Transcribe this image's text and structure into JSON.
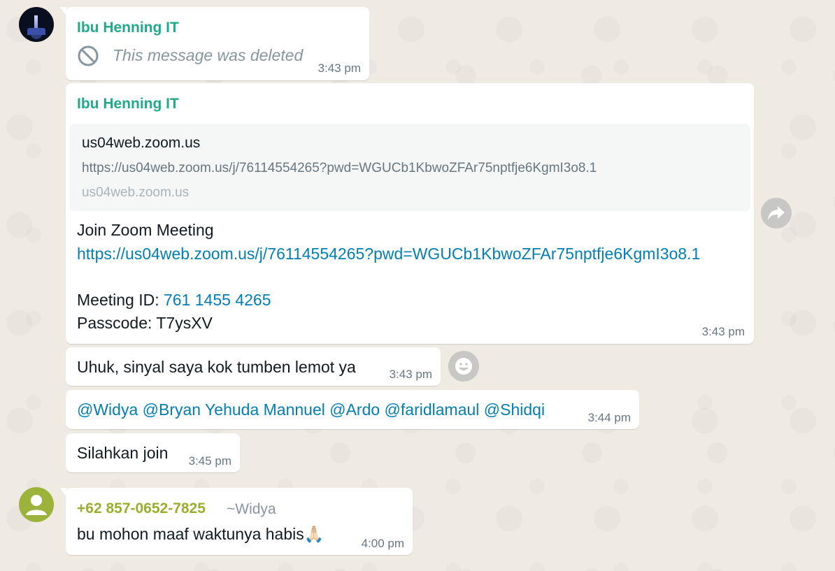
{
  "messages": {
    "m1": {
      "sender": "Ibu Henning IT",
      "deleted_text": "This message was deleted",
      "time": "3:43 pm"
    },
    "m2": {
      "sender": "Ibu Henning IT",
      "preview": {
        "title": "us04web.zoom.us",
        "description": "https://us04web.zoom.us/j/76114554265?pwd=WGUCb1KbwoZFAr75nptfje6KgmI3o8.1",
        "domain": "us04web.zoom.us"
      },
      "line1": "Join Zoom Meeting",
      "link": "https://us04web.zoom.us/j/76114554265?pwd=WGUCb1KbwoZFAr75nptfje6KgmI3o8.1",
      "meeting_id_label": "Meeting ID: ",
      "meeting_id_value": "761 1455 4265",
      "passcode": "Passcode: T7ysXV",
      "time": "3:43 pm"
    },
    "m3": {
      "text": "Uhuk, sinyal saya kok tumben lemot ya",
      "time": "3:43 pm"
    },
    "m4": {
      "mentions": "@Widya @Bryan Yehuda Mannuel @Ardo @faridlamaul @Shidqi",
      "time": "3:44 pm"
    },
    "m5": {
      "text": "Silahkan join",
      "time": "3:45 pm"
    },
    "m6": {
      "sender_phone": "+62 857-0652-7825",
      "push_name": "~Widya",
      "text": "bu mohon maaf waktunya habis🙏🏻",
      "time": "4:00 pm"
    }
  },
  "icons": {
    "deleted": "block-icon",
    "forward": "forward-icon",
    "emoji": "emoji-react-icon",
    "default_avatar": "user-avatar-icon"
  },
  "colors": {
    "background": "#efeae2",
    "bubble": "#ffffff",
    "sender_green": "#1fab89",
    "phone_sender": "#9aae2e",
    "link": "#027eb5",
    "meta": "#667781"
  }
}
